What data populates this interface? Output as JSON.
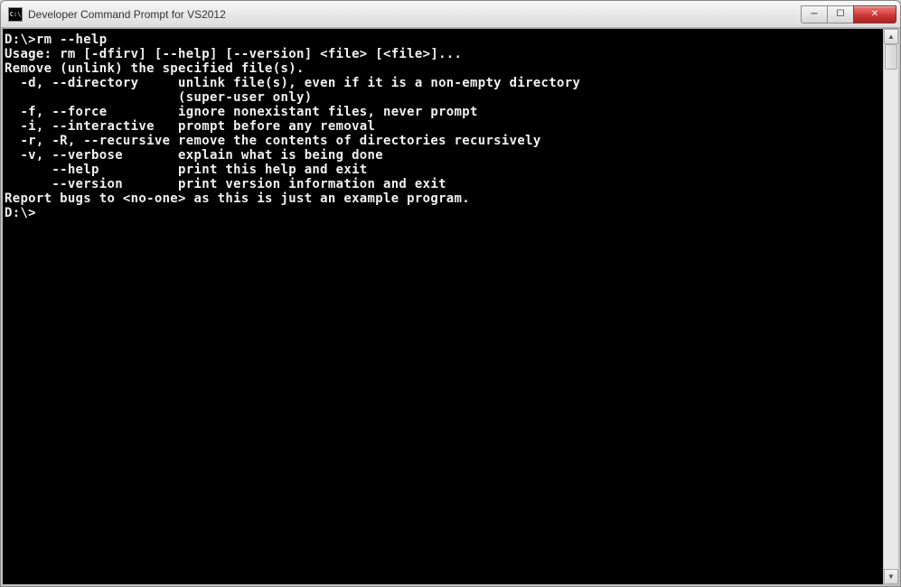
{
  "window": {
    "title": "Developer Command Prompt for VS2012",
    "icon_label": "C:\\"
  },
  "controls": {
    "minimize": "─",
    "maximize": "☐",
    "close": "✕"
  },
  "scrollbar": {
    "up": "▲",
    "down": "▼"
  },
  "terminal": {
    "lines": [
      "",
      "D:\\>rm --help",
      "Usage: rm [-dfirv] [--help] [--version] <file> [<file>]...",
      "Remove (unlink) the specified file(s).",
      "",
      "  -d, --directory     unlink file(s), even if it is a non-empty directory",
      "                      (super-user only)",
      "  -f, --force         ignore nonexistant files, never prompt",
      "  -i, --interactive   prompt before any removal",
      "  -r, -R, --recursive remove the contents of directories recursively",
      "  -v, --verbose       explain what is being done",
      "      --help          print this help and exit",
      "      --version       print version information and exit",
      "",
      "Report bugs to <no-one> as this is just an example program.",
      "",
      "D:\\>"
    ]
  }
}
